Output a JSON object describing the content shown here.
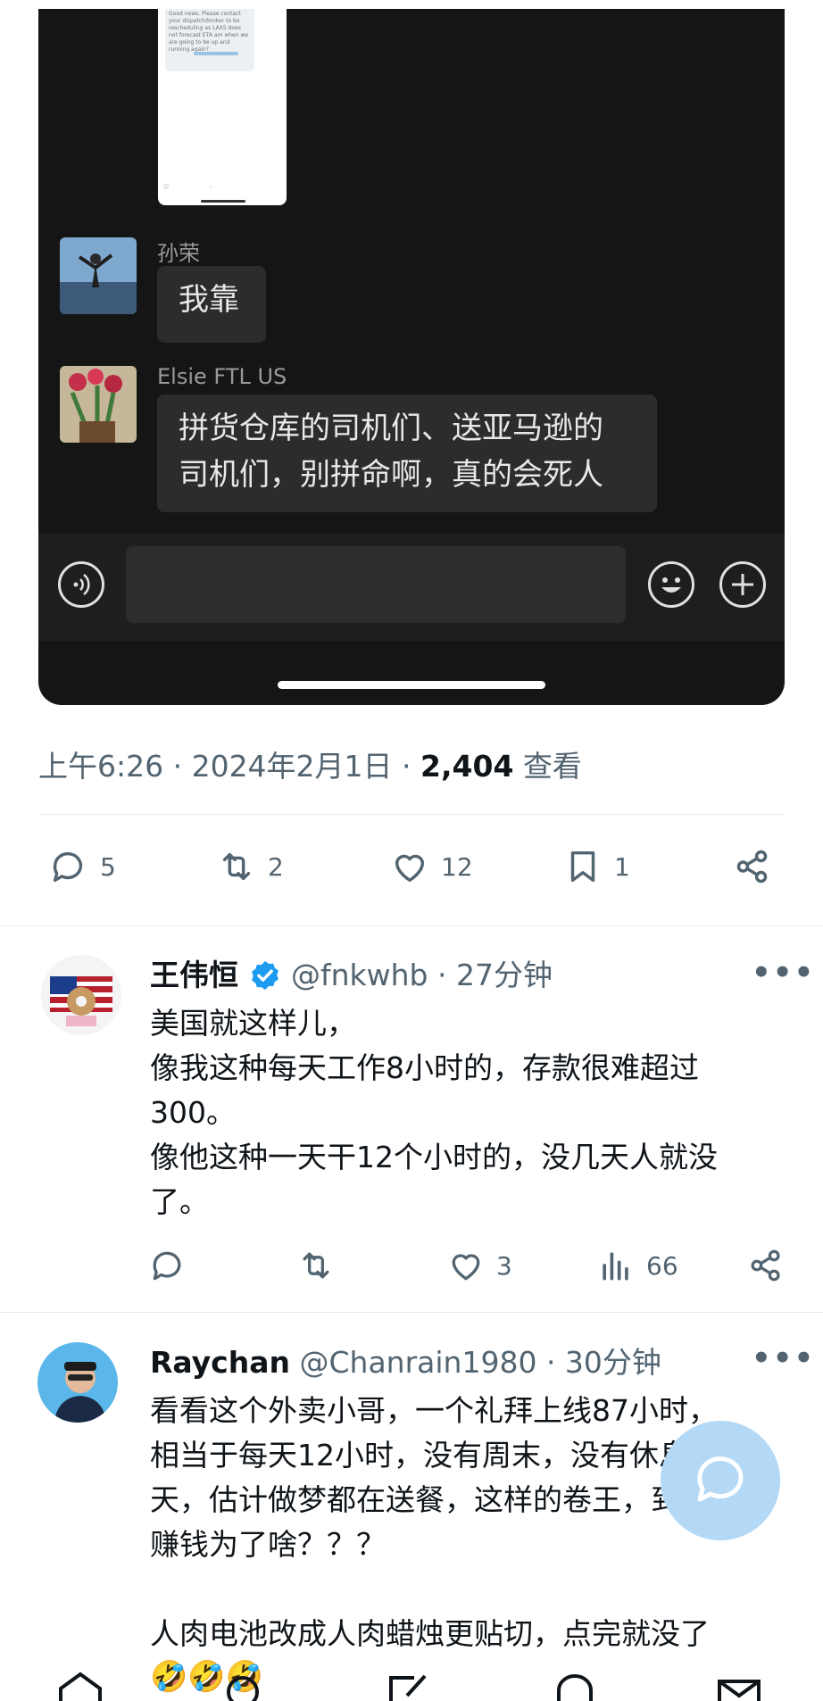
{
  "chat": {
    "mini_screenshot_text": "Good news. Please contact your dispatch/broker to be rescheduling as LAX5 does not forecast ETA am when we are going to be up and running again?",
    "messages": [
      {
        "sender": "孙荣",
        "lines": [
          "我靠"
        ]
      },
      {
        "sender": "Elsie FTL US",
        "lines": [
          "拼货仓库的司机们、送亚马逊的",
          "司机们，别拼命啊，真的会死人"
        ]
      }
    ]
  },
  "tweet_meta": {
    "time_date": "上午6:26 · 2024年2月1日 · ",
    "views": "2,404",
    "views_label": " 查看"
  },
  "tweet_actions": {
    "replies": "5",
    "retweets": "2",
    "likes": "12",
    "bookmarks": "1"
  },
  "replies": [
    {
      "name": "王伟恒",
      "verified": true,
      "handle_time": "@fnkwhb · 27分钟",
      "lines": [
        "美国就这样儿，",
        "像我这种每天工作8小时的，存款很难超过",
        "300。",
        "像他这种一天干12个小时的，没几天人就没",
        "了。"
      ],
      "replies": "",
      "retweets": "",
      "likes": "3",
      "views": "66"
    },
    {
      "name": "Raychan",
      "verified": false,
      "handle_time": "@Chanrain1980 · 30分钟",
      "lines": [
        "看看这个外卖小哥，一个礼拜上线87小时，",
        "相当于每天12小时，没有周末，没有休息",
        "天，估计做梦都在送餐，这样的卷王，到底",
        "赚钱为了啥？？？",
        "",
        "人肉电池改成人肉蜡烛更贴切，点完就没了"
      ],
      "emoji": "🤣🤣🤣"
    }
  ],
  "colors": {
    "chat_bg": "#151515",
    "bubble": "#2c2c2c",
    "muted": "#536471",
    "verified": "#1d9bf0",
    "fab": "#b3d9f6"
  }
}
